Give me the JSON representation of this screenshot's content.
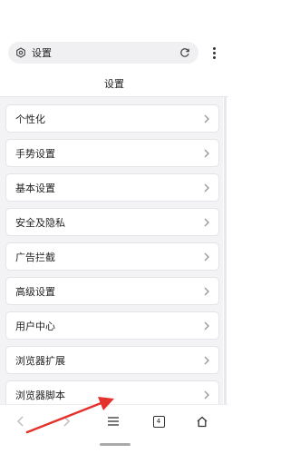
{
  "address_bar": {
    "text": "设置",
    "icon": "gear-icon",
    "reload_icon": "reload-icon"
  },
  "menu": {
    "icon": "more-vertical-icon"
  },
  "header": {
    "title": "设置"
  },
  "settings_items": [
    {
      "label": "个性化"
    },
    {
      "label": "手势设置"
    },
    {
      "label": "基本设置"
    },
    {
      "label": "安全及隐私"
    },
    {
      "label": "广告拦截"
    },
    {
      "label": "高级设置"
    },
    {
      "label": "用户中心"
    },
    {
      "label": "浏览器扩展"
    },
    {
      "label": "浏览器脚本"
    }
  ],
  "bottom_nav": {
    "back_icon": "back-icon",
    "forward_icon": "forward-icon",
    "menu_icon": "hamburger-menu-icon",
    "tab_count": "4",
    "home_icon": "home-icon"
  },
  "colors": {
    "list_background": "#f3f3f6",
    "arrow_annotation": "#e5312b"
  }
}
